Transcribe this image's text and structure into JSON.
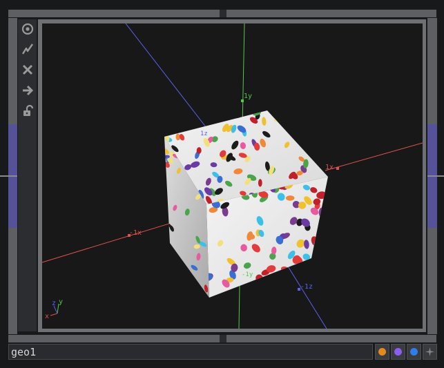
{
  "node": {
    "name": "geo1"
  },
  "viewport": {
    "axis_labels": {
      "pos_y": "1y",
      "pos_x": "1x",
      "neg_x": "-1x",
      "pos_z": "1z",
      "neg_z": "-1z",
      "neg_y": "-1y"
    },
    "gizmo": {
      "x": "x",
      "y": "y",
      "z": "z"
    }
  },
  "toolbar": {
    "tools": [
      "viewer-icon",
      "active-icon",
      "bypass-icon",
      "display-icon",
      "lock-icon"
    ]
  },
  "flags": [
    {
      "name": "orange-flag",
      "color": "#e28a1f"
    },
    {
      "name": "purple-flag",
      "color": "#8a5ef0"
    },
    {
      "name": "blue-flag",
      "color": "#2f7de8"
    },
    {
      "name": "pin-flag",
      "color": "#8a8a8a"
    }
  ],
  "colors": {
    "x_axis": "#e0524f",
    "y_axis": "#55c84e",
    "z_axis": "#5a62e8"
  }
}
